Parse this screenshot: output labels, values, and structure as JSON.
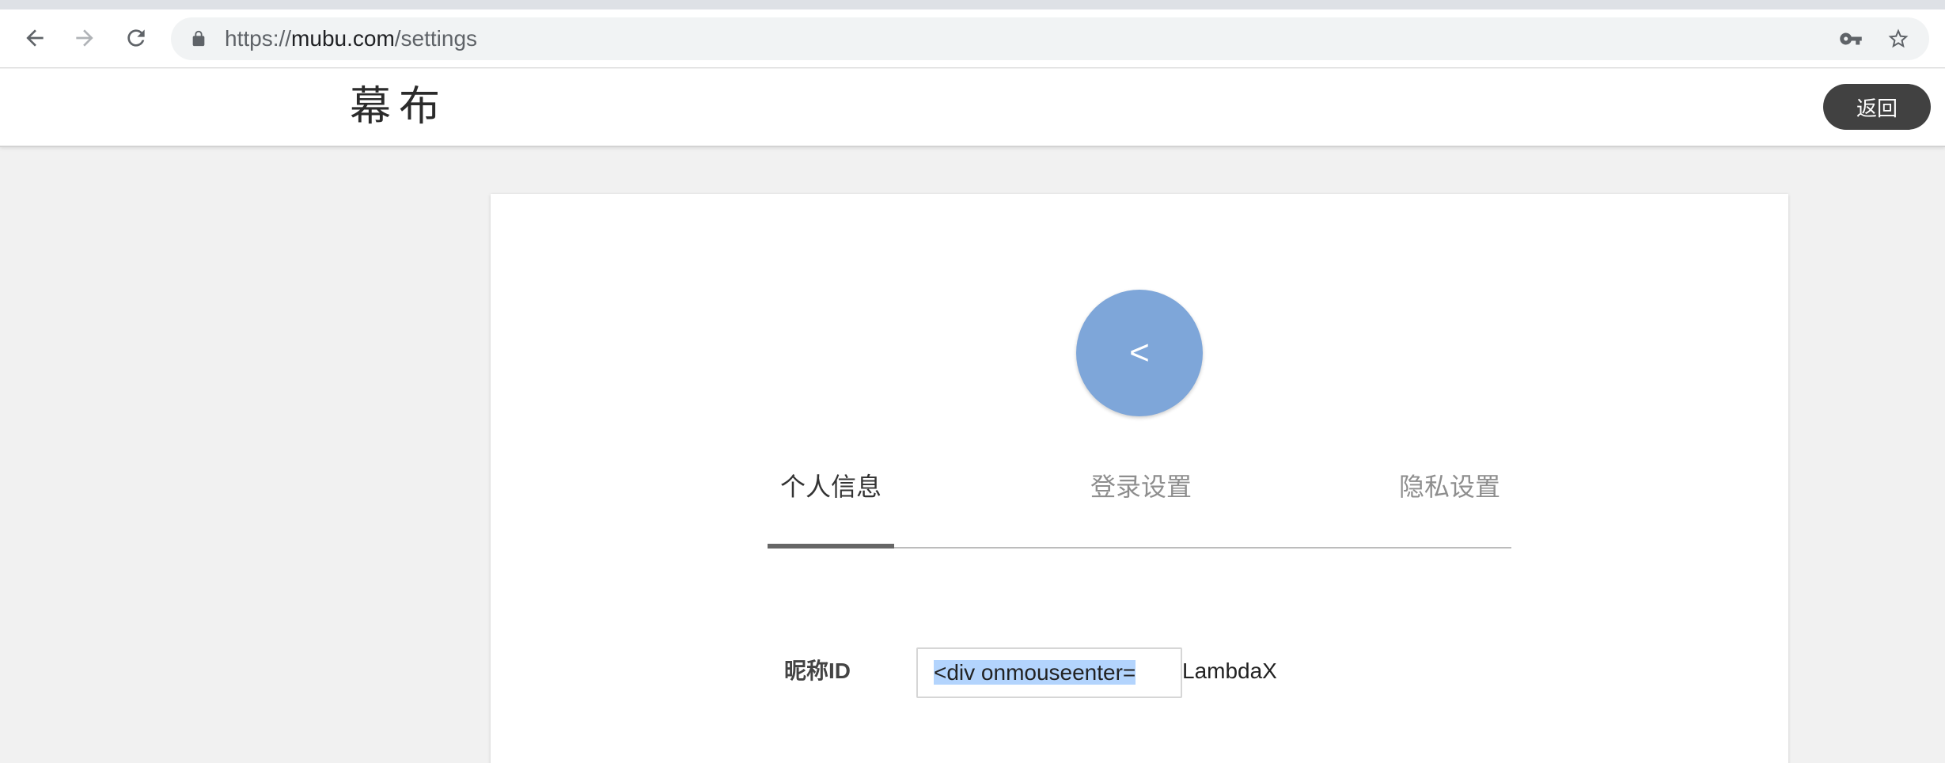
{
  "browser": {
    "url_secure": "https://",
    "url_host": "mubu.com",
    "url_path": "/settings"
  },
  "header": {
    "logo_text": "幕布",
    "back_label": "返回"
  },
  "profile": {
    "avatar_glyph": "<",
    "avatar_color": "#7ea6d9"
  },
  "tabs": [
    {
      "label": "个人信息",
      "active": true
    },
    {
      "label": "登录设置",
      "active": false
    },
    {
      "label": "隐私设置",
      "active": false
    }
  ],
  "form": {
    "nickname_label": "昵称ID",
    "nickname_value": "<div onmouseenter=",
    "trailing_text": "LambdaX"
  },
  "colors": {
    "accent": "#7ea6d9",
    "button_dark": "#414141",
    "selection": "#b3d4fd"
  },
  "icons": [
    "back-arrow-icon",
    "forward-arrow-icon",
    "reload-icon",
    "lock-icon",
    "key-icon",
    "star-icon"
  ]
}
